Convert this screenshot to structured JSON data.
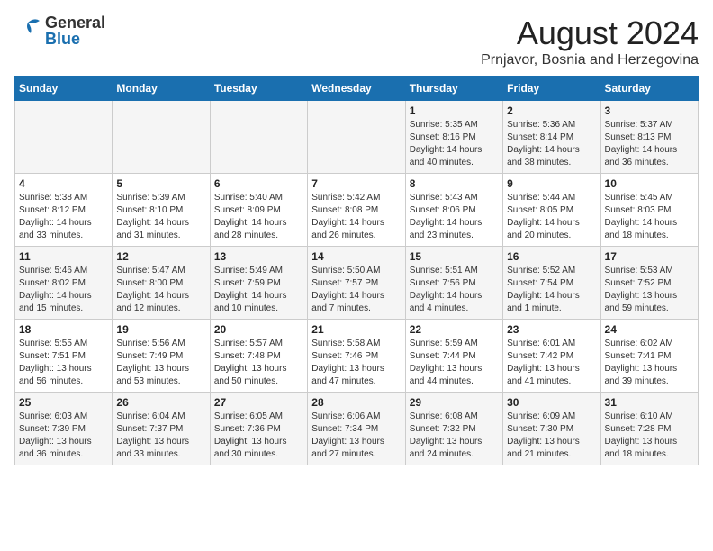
{
  "header": {
    "logo_general": "General",
    "logo_blue": "Blue",
    "month_year": "August 2024",
    "location": "Prnjavor, Bosnia and Herzegovina"
  },
  "weekdays": [
    "Sunday",
    "Monday",
    "Tuesday",
    "Wednesday",
    "Thursday",
    "Friday",
    "Saturday"
  ],
  "weeks": [
    [
      {
        "day": "",
        "info": ""
      },
      {
        "day": "",
        "info": ""
      },
      {
        "day": "",
        "info": ""
      },
      {
        "day": "",
        "info": ""
      },
      {
        "day": "1",
        "info": "Sunrise: 5:35 AM\nSunset: 8:16 PM\nDaylight: 14 hours\nand 40 minutes."
      },
      {
        "day": "2",
        "info": "Sunrise: 5:36 AM\nSunset: 8:14 PM\nDaylight: 14 hours\nand 38 minutes."
      },
      {
        "day": "3",
        "info": "Sunrise: 5:37 AM\nSunset: 8:13 PM\nDaylight: 14 hours\nand 36 minutes."
      }
    ],
    [
      {
        "day": "4",
        "info": "Sunrise: 5:38 AM\nSunset: 8:12 PM\nDaylight: 14 hours\nand 33 minutes."
      },
      {
        "day": "5",
        "info": "Sunrise: 5:39 AM\nSunset: 8:10 PM\nDaylight: 14 hours\nand 31 minutes."
      },
      {
        "day": "6",
        "info": "Sunrise: 5:40 AM\nSunset: 8:09 PM\nDaylight: 14 hours\nand 28 minutes."
      },
      {
        "day": "7",
        "info": "Sunrise: 5:42 AM\nSunset: 8:08 PM\nDaylight: 14 hours\nand 26 minutes."
      },
      {
        "day": "8",
        "info": "Sunrise: 5:43 AM\nSunset: 8:06 PM\nDaylight: 14 hours\nand 23 minutes."
      },
      {
        "day": "9",
        "info": "Sunrise: 5:44 AM\nSunset: 8:05 PM\nDaylight: 14 hours\nand 20 minutes."
      },
      {
        "day": "10",
        "info": "Sunrise: 5:45 AM\nSunset: 8:03 PM\nDaylight: 14 hours\nand 18 minutes."
      }
    ],
    [
      {
        "day": "11",
        "info": "Sunrise: 5:46 AM\nSunset: 8:02 PM\nDaylight: 14 hours\nand 15 minutes."
      },
      {
        "day": "12",
        "info": "Sunrise: 5:47 AM\nSunset: 8:00 PM\nDaylight: 14 hours\nand 12 minutes."
      },
      {
        "day": "13",
        "info": "Sunrise: 5:49 AM\nSunset: 7:59 PM\nDaylight: 14 hours\nand 10 minutes."
      },
      {
        "day": "14",
        "info": "Sunrise: 5:50 AM\nSunset: 7:57 PM\nDaylight: 14 hours\nand 7 minutes."
      },
      {
        "day": "15",
        "info": "Sunrise: 5:51 AM\nSunset: 7:56 PM\nDaylight: 14 hours\nand 4 minutes."
      },
      {
        "day": "16",
        "info": "Sunrise: 5:52 AM\nSunset: 7:54 PM\nDaylight: 14 hours\nand 1 minute."
      },
      {
        "day": "17",
        "info": "Sunrise: 5:53 AM\nSunset: 7:52 PM\nDaylight: 13 hours\nand 59 minutes."
      }
    ],
    [
      {
        "day": "18",
        "info": "Sunrise: 5:55 AM\nSunset: 7:51 PM\nDaylight: 13 hours\nand 56 minutes."
      },
      {
        "day": "19",
        "info": "Sunrise: 5:56 AM\nSunset: 7:49 PM\nDaylight: 13 hours\nand 53 minutes."
      },
      {
        "day": "20",
        "info": "Sunrise: 5:57 AM\nSunset: 7:48 PM\nDaylight: 13 hours\nand 50 minutes."
      },
      {
        "day": "21",
        "info": "Sunrise: 5:58 AM\nSunset: 7:46 PM\nDaylight: 13 hours\nand 47 minutes."
      },
      {
        "day": "22",
        "info": "Sunrise: 5:59 AM\nSunset: 7:44 PM\nDaylight: 13 hours\nand 44 minutes."
      },
      {
        "day": "23",
        "info": "Sunrise: 6:01 AM\nSunset: 7:42 PM\nDaylight: 13 hours\nand 41 minutes."
      },
      {
        "day": "24",
        "info": "Sunrise: 6:02 AM\nSunset: 7:41 PM\nDaylight: 13 hours\nand 39 minutes."
      }
    ],
    [
      {
        "day": "25",
        "info": "Sunrise: 6:03 AM\nSunset: 7:39 PM\nDaylight: 13 hours\nand 36 minutes."
      },
      {
        "day": "26",
        "info": "Sunrise: 6:04 AM\nSunset: 7:37 PM\nDaylight: 13 hours\nand 33 minutes."
      },
      {
        "day": "27",
        "info": "Sunrise: 6:05 AM\nSunset: 7:36 PM\nDaylight: 13 hours\nand 30 minutes."
      },
      {
        "day": "28",
        "info": "Sunrise: 6:06 AM\nSunset: 7:34 PM\nDaylight: 13 hours\nand 27 minutes."
      },
      {
        "day": "29",
        "info": "Sunrise: 6:08 AM\nSunset: 7:32 PM\nDaylight: 13 hours\nand 24 minutes."
      },
      {
        "day": "30",
        "info": "Sunrise: 6:09 AM\nSunset: 7:30 PM\nDaylight: 13 hours\nand 21 minutes."
      },
      {
        "day": "31",
        "info": "Sunrise: 6:10 AM\nSunset: 7:28 PM\nDaylight: 13 hours\nand 18 minutes."
      }
    ]
  ]
}
